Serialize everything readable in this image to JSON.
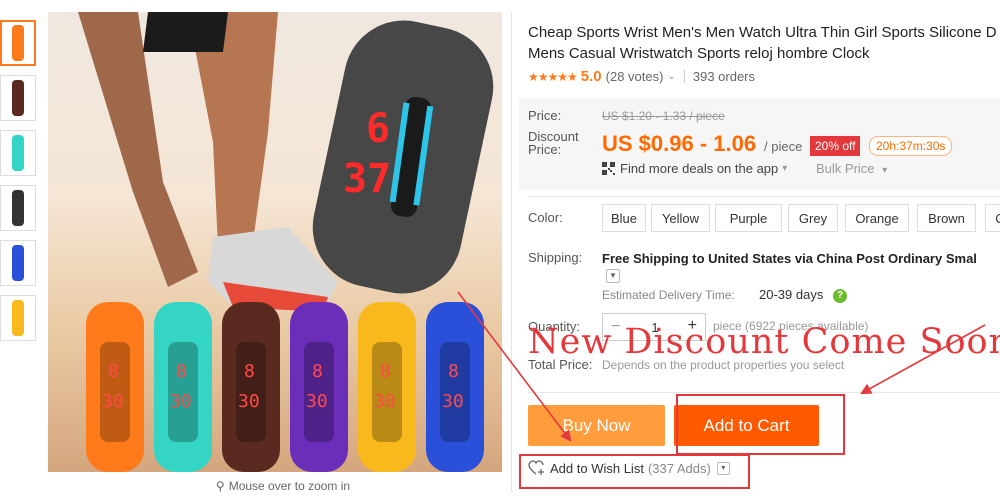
{
  "thumbnails": [
    {
      "color": "#ff7a1a",
      "active": true
    },
    {
      "color": "#5a2a20",
      "active": false
    },
    {
      "color": "#35d5c5",
      "active": false
    },
    {
      "color": "#333333",
      "active": false
    },
    {
      "color": "#2a4fd8",
      "active": false
    },
    {
      "color": "#f7b91c",
      "active": false
    }
  ],
  "main_image": {
    "watch_display": {
      "top": "6",
      "bottom": "37"
    },
    "band_display": {
      "top": "8",
      "bottom": "30"
    },
    "band_colors": [
      "#ff7a1a",
      "#35d5c5",
      "#5a2a20",
      "#6a2eb8",
      "#f7b91c",
      "#2a4fd8"
    ],
    "big_watch_color": "#474747"
  },
  "zoom_hint": "Mouse over to zoom in",
  "product": {
    "title_line1": "Cheap Sports Wrist Men's Men Watch Ultra Thin Girl Sports Silicone D",
    "title_line2": "Mens Casual Wristwatch Sports reloj hombre Clock",
    "stars": "★★★★★",
    "rating": "5.0",
    "votes": "(28 votes)",
    "orders": "393 orders"
  },
  "pricing": {
    "price_label": "Price:",
    "original_price": "US $1.20 - 1.33 / piece",
    "discount_label_1": "Discount",
    "discount_label_2": "Price:",
    "discount_price": "US $0.96 - 1.06",
    "per_piece": "/ piece",
    "off_badge": "20% off",
    "timer": "20h:37m:30s",
    "app_deals": "Find more deals on the app",
    "bulk_price": "Bulk Price"
  },
  "colors": {
    "label": "Color:",
    "options": [
      "Blue",
      "Yellow",
      "Purple",
      "Grey",
      "Orange",
      "Brown",
      "C"
    ]
  },
  "shipping": {
    "label": "Shipping:",
    "text": "Free Shipping to United States via China Post Ordinary Smal",
    "eta_label": "Estimated Delivery Time:",
    "eta_value": "20-39 days"
  },
  "quantity": {
    "label": "Quantity:",
    "minus": "−",
    "value": "1",
    "plus": "+",
    "available": "piece (6922 pieces available)"
  },
  "total": {
    "label": "Total Price:",
    "value": "Depends on the product properties you select"
  },
  "promo_overlay": "New Discount Come Soon",
  "actions": {
    "buy_now": "Buy Now",
    "add_to_cart": "Add to Cart",
    "wish_list": "Add to Wish List",
    "wish_count": "(337 Adds)"
  },
  "theme": {
    "accent": "#ff6a00",
    "annotation_red": "#e4393c"
  }
}
